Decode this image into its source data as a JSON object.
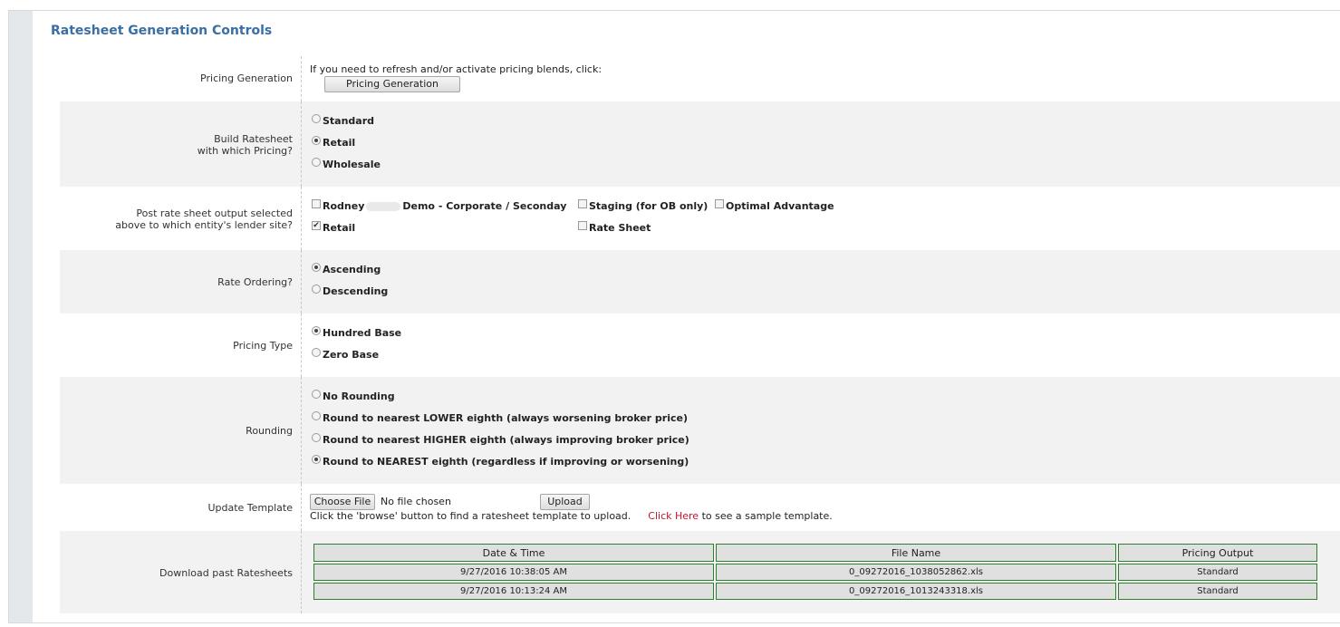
{
  "page": {
    "title": "Ratesheet Generation Controls"
  },
  "pricing_generation": {
    "label": "Pricing Generation",
    "instruction": "If you need to refresh and/or activate pricing blends, click:",
    "button_label": "Pricing Generation"
  },
  "build_ratesheet": {
    "label_line1": "Build Ratesheet",
    "label_line2": "with which Pricing?",
    "options": [
      {
        "label": "Standard",
        "selected": false
      },
      {
        "label": "Retail",
        "selected": true
      },
      {
        "label": "Wholesale",
        "selected": false
      }
    ]
  },
  "post_output": {
    "label_line1": "Post rate sheet output selected",
    "label_line2": "above to which entity's lender site?",
    "options": [
      {
        "label_part1": "Rodney",
        "label_part2": "Demo - Corporate / Seconday",
        "checked": false
      },
      {
        "label": "Staging (for OB only)",
        "checked": false
      },
      {
        "label": "Optimal Advantage",
        "checked": false
      },
      {
        "label": "Retail",
        "checked": true
      },
      {
        "label": "Rate Sheet",
        "checked": false
      }
    ]
  },
  "rate_ordering": {
    "label": "Rate Ordering?",
    "options": [
      {
        "label": "Ascending",
        "selected": true
      },
      {
        "label": "Descending",
        "selected": false
      }
    ]
  },
  "pricing_type": {
    "label": "Pricing Type",
    "options": [
      {
        "label": "Hundred Base",
        "selected": true
      },
      {
        "label": "Zero Base",
        "selected": false
      }
    ]
  },
  "rounding": {
    "label": "Rounding",
    "options": [
      {
        "label": "No Rounding",
        "selected": false
      },
      {
        "label": "Round to nearest LOWER eighth (always worsening broker price)",
        "selected": false
      },
      {
        "label": "Round to nearest HIGHER eighth (always improving broker price)",
        "selected": false
      },
      {
        "label": "Round to NEAREST eighth (regardless if improving or worsening)",
        "selected": true
      }
    ]
  },
  "update_template": {
    "label": "Update Template",
    "choose_file_label": "Choose File",
    "no_file_text": "No file chosen",
    "upload_label": "Upload",
    "help_text": "Click the 'browse' button to find a ratesheet template to upload.",
    "link_text": "Click Here",
    "link_suffix": "to see a sample template."
  },
  "download_past": {
    "label": "Download past Ratesheets",
    "columns": [
      "Date & Time",
      "File Name",
      "Pricing Output"
    ],
    "rows": [
      [
        "9/27/2016 10:38:05 AM",
        "0_09272016_1038052862.xls",
        "Standard"
      ],
      [
        "9/27/2016 10:13:24 AM",
        "0_09272016_1013243318.xls",
        "Standard"
      ]
    ]
  }
}
